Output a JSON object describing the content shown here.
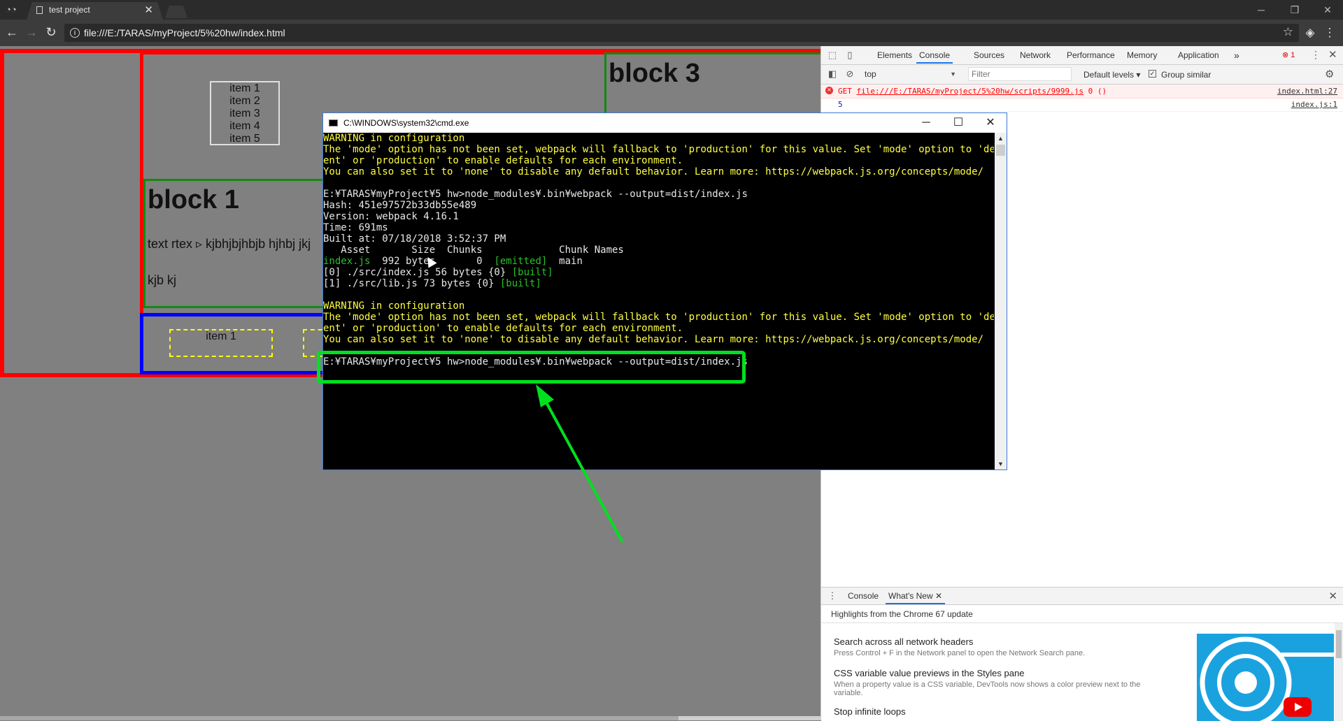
{
  "browser": {
    "tab_title": "test project",
    "url": "file:///E:/TARAS/myProject/5%20hw/index.html",
    "icons": {
      "app": "incognito-icon",
      "tab": "page-icon",
      "back": "back-arrow-icon",
      "forward": "forward-arrow-icon",
      "reload": "reload-icon",
      "info": "info-icon",
      "star": "star-icon",
      "menu": "kebab-menu-icon"
    }
  },
  "page": {
    "list_items": [
      "item 1",
      "item 2",
      "item 3",
      "item 4",
      "item 5"
    ],
    "block1_title": "block 1",
    "block1_text1": "text rtex ▹ kjbhjbjhbjb hjhbj jkj",
    "block1_text2": "kjb kj",
    "block3_title": "block 3",
    "dashed_item": "item 1"
  },
  "devtools": {
    "tabs": [
      "Elements",
      "Console",
      "Sources",
      "Network",
      "Performance",
      "Memory",
      "Application"
    ],
    "active_tab": "Console",
    "more_tabs": "»",
    "error_count": "1",
    "context": "top",
    "filter_placeholder": "Filter",
    "levels": "Default levels ▾",
    "group_similar": "Group similar",
    "error_message": {
      "method": "GET",
      "url": "file:///E:/TARAS/myProject/5%20hw/scripts/9999.js",
      "status": "0 ()",
      "source": "index.html:27"
    },
    "log_message": {
      "value": "5",
      "source": "index.js:1"
    },
    "drawer": {
      "tabs": [
        "Console",
        "What's New"
      ],
      "active": "What's New",
      "highlights": "Highlights from the Chrome 67 update",
      "features": [
        {
          "title": "Search across all network headers",
          "desc": "Press Control + F in the Network panel to open the Network Search pane."
        },
        {
          "title": "CSS variable value previews in the Styles pane",
          "desc": "When a property value is a CSS variable, DevTools now shows a color preview next to the variable."
        },
        {
          "title": "Stop infinite loops",
          "desc": ""
        }
      ]
    }
  },
  "cmd": {
    "title": "C:\\WINDOWS\\system32\\cmd.exe",
    "warning": {
      "head": "WARNING in configuration",
      "line1": "The 'mode' option has not been set, webpack will fallback to 'production' for this value. Set 'mode' option to 'developm",
      "line2": "ent' or 'production' to enable defaults for each environment.",
      "line3": "You can also set it to 'none' to disable any default behavior. Learn more: https://webpack.js.org/concepts/mode/"
    },
    "prompt": "E:¥TARAS¥myProject¥5 hw>node_modules¥.bin¥webpack --output=dist/index.js",
    "build": {
      "hash": "Hash: 451e97572b33db55e489",
      "version": "Version: webpack 4.16.1",
      "time": "Time: 691ms",
      "built_at": "Built at: 07/18/2018 3:52:37 PM",
      "header": "   Asset       Size  Chunks             Chunk Names",
      "asset_name": "index.js",
      "asset_mid": "  992 bytes       0  ",
      "asset_tag": "[emitted]",
      "asset_chunk": "  main",
      "mod0": "[0] ./src/index.js 56 bytes {0} ",
      "mod1": "[1] ./src/lib.js 73 bytes {0} ",
      "built_tag": "[built]"
    }
  },
  "colors": {
    "outer_border": "#ff0000",
    "block_border": "#128a12",
    "blue_border": "#0000ff",
    "dashed": "#ffff00",
    "cmd_yellow": "#ffff3f",
    "cmd_green": "#27c227",
    "highlight": "#00e01e"
  }
}
